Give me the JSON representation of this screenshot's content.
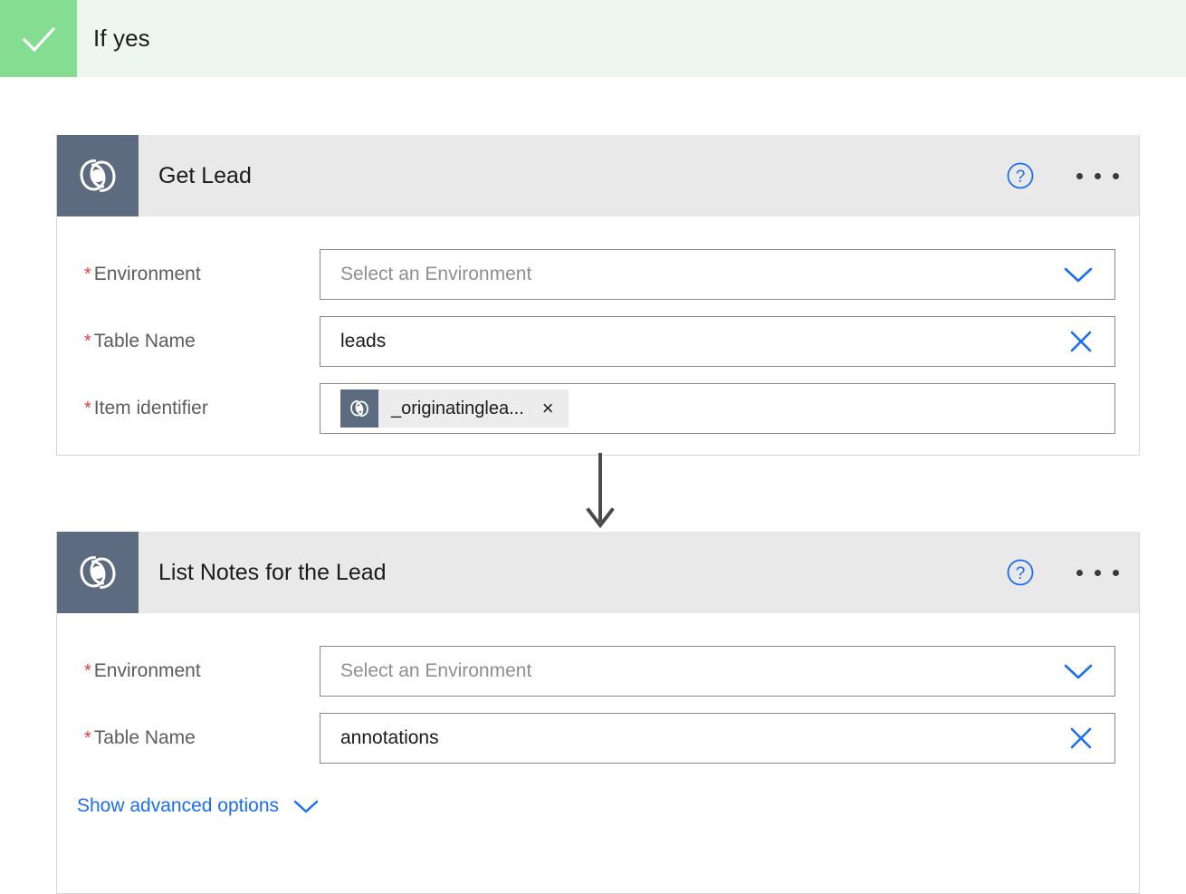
{
  "branch": {
    "label": "If yes",
    "icon": "check-icon",
    "tile_color": "#85dd92",
    "band_color": "#edf7ef"
  },
  "colors": {
    "accent_blue": "#1a6ef5",
    "required_red": "#e23c3c",
    "card_header_bg": "#e9e9e9",
    "icon_tile_bg": "#5c6b7f",
    "connector": "#4a4a4a"
  },
  "cards": [
    {
      "title": "Get Lead",
      "icon": "dataverse-icon",
      "help_icon": "help-circle-icon",
      "menu_icon": "ellipsis-icon",
      "fields": [
        {
          "label": "Environment",
          "required": true,
          "value": "",
          "placeholder": "Select an Environment",
          "affordance": "chevron-down-icon"
        },
        {
          "label": "Table Name",
          "required": true,
          "value": "leads",
          "placeholder": "",
          "affordance": "clear-x-icon"
        },
        {
          "label": "Item identifier",
          "required": true,
          "value": "",
          "placeholder": "",
          "affordance": "none",
          "token": {
            "text": "_originatinglea...",
            "icon": "dataverse-icon",
            "remove_label": "×"
          }
        }
      ]
    },
    {
      "title": "List Notes for the Lead",
      "icon": "dataverse-icon",
      "help_icon": "help-circle-icon",
      "menu_icon": "ellipsis-icon",
      "fields": [
        {
          "label": "Environment",
          "required": true,
          "value": "",
          "placeholder": "Select an Environment",
          "affordance": "chevron-down-icon"
        },
        {
          "label": "Table Name",
          "required": true,
          "value": "annotations",
          "placeholder": "",
          "affordance": "clear-x-icon"
        }
      ],
      "advanced_options": {
        "label": "Show advanced options",
        "icon": "chevron-down-icon"
      }
    }
  ]
}
